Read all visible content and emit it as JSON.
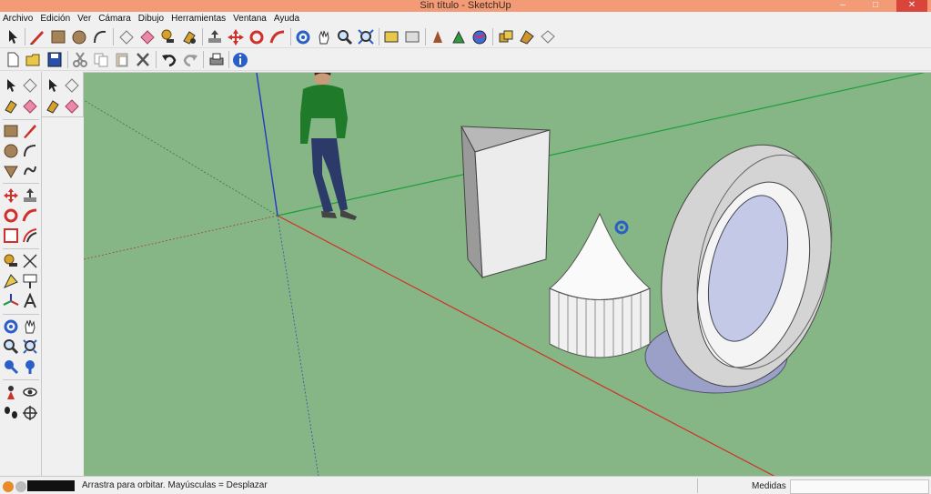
{
  "window": {
    "title": "Sin título - SketchUp",
    "minimize_glyph": "–",
    "maximize_glyph": "□",
    "close_glyph": "✕"
  },
  "menu": [
    "Archivo",
    "Edición",
    "Ver",
    "Cámara",
    "Dibujo",
    "Herramientas",
    "Ventana",
    "Ayuda"
  ],
  "toolbar1_icons": [
    "select-icon",
    "pencil-icon",
    "rectangle-icon",
    "circle-icon",
    "arc-icon",
    "eraser-icon",
    "paint-bucket-icon",
    "tape-measure-icon",
    "paint-icon",
    "push-pull-icon",
    "move-icon",
    "rotate-icon",
    "follow-me-icon",
    "orbit-icon",
    "pan-icon",
    "zoom-icon",
    "zoom-extents-icon",
    "section-icon",
    "walk-icon",
    "position-camera-icon",
    "look-around-icon",
    "globe-icon",
    "components-icon",
    "materials-icon",
    "styles-icon"
  ],
  "toolbar2_icons": [
    "new-icon",
    "open-icon",
    "save-icon",
    "cut-icon",
    "copy-icon",
    "paste-icon",
    "delete-icon",
    "undo-icon",
    "redo-icon",
    "print-icon",
    "info-icon"
  ],
  "left_tools": [
    "select-icon",
    "make-component-icon",
    "paint-bucket-icon",
    "eraser-icon",
    "rectangle-icon",
    "line-icon",
    "circle-icon",
    "arc-icon",
    "polygon-icon",
    "freehand-icon",
    "move-icon",
    "push-pull-icon",
    "rotate-icon",
    "follow-me-icon",
    "scale-icon",
    "offset-icon",
    "tape-measure-icon",
    "dimension-icon",
    "protractor-icon",
    "text-icon",
    "axes-icon",
    "3d-text-icon",
    "orbit-icon",
    "pan-icon",
    "zoom-icon",
    "zoom-window-icon",
    "zoom-extents-icon",
    "previous-icon",
    "position-camera-icon",
    "look-around-icon",
    "walk-icon",
    "section-plane-icon"
  ],
  "status": {
    "hint": "Arrastra para orbitar. Mayúsculas = Desplazar",
    "measure_label": "Medidas",
    "measure_value": ""
  },
  "colors": {
    "titlebar": "#f39a76",
    "viewport_ground": "#86b685",
    "axis_red": "#d0302a",
    "axis_green": "#1f9e3a",
    "axis_blue": "#2a35c8"
  }
}
